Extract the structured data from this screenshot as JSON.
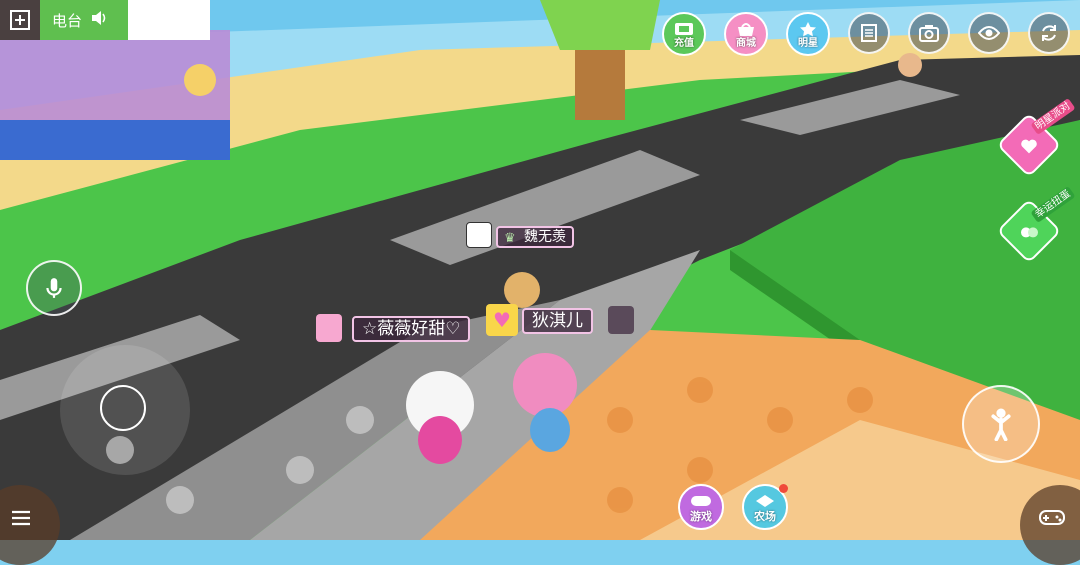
{
  "hud": {
    "radio_label": "电台",
    "top_features": [
      {
        "label": "充值",
        "color": "#5cc85a"
      },
      {
        "label": "商城",
        "color": "#f58fc4"
      },
      {
        "label": "明星",
        "color": "#5cc8f0"
      }
    ],
    "bottom_buttons": [
      {
        "label": "游戏",
        "color": "#c06ae0"
      },
      {
        "label": "农场",
        "color": "#55c8e0"
      }
    ],
    "side_events": [
      {
        "caption": "明星派对",
        "color": "#f36bb7"
      },
      {
        "caption": "幸运扭蛋",
        "color": "#4fd45a"
      }
    ]
  },
  "players": {
    "nearby": "魏无羡",
    "left": "☆薇薇好甜♡",
    "right": "狄淇儿"
  },
  "colors": {
    "road": "#3a3a3a",
    "grass": "#4cc54a",
    "sand": "#f2d98a",
    "orange_floor": "#f2a85c",
    "accent_pink": "#f36bb7"
  }
}
